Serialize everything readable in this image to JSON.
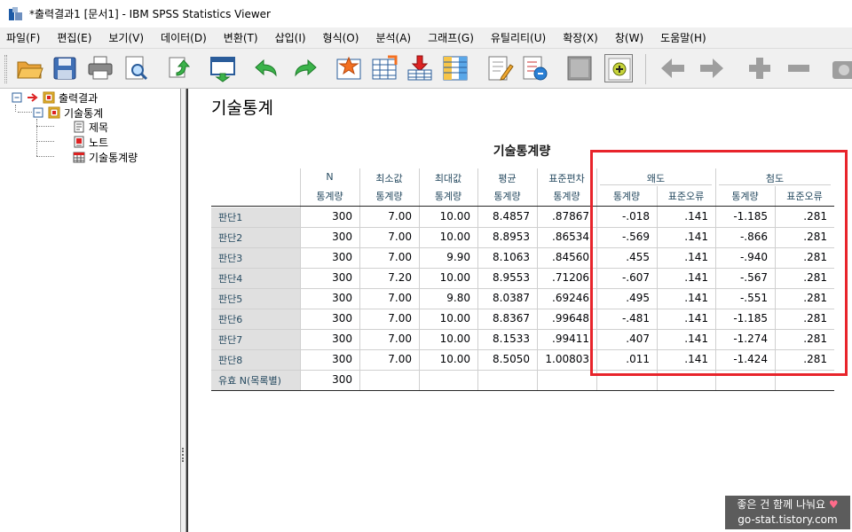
{
  "window": {
    "title": "*출력결과1 [문서1] - IBM SPSS Statistics Viewer"
  },
  "menu": [
    "파일(F)",
    "편집(E)",
    "보기(V)",
    "데이터(D)",
    "변환(T)",
    "삽입(I)",
    "형식(O)",
    "분석(A)",
    "그래프(G)",
    "유틸리티(U)",
    "확장(X)",
    "창(W)",
    "도움말(H)"
  ],
  "toolbar": {
    "icons": [
      "open-icon",
      "save-icon",
      "print-icon",
      "print-preview-icon",
      "export-icon",
      "goto-data-icon",
      "undo-icon",
      "redo-icon",
      "goto-case-icon",
      "goto-variable-icon",
      "insert-cases-icon",
      "split-file-icon",
      "select-cases-icon",
      "value-labels-icon",
      "designate-window-icon",
      "show-all-icon",
      "promote-icon",
      "demote-icon",
      "expand-icon",
      "collapse-icon",
      "show-icon"
    ]
  },
  "outline": {
    "root": "출력결과",
    "section": "기술통계",
    "children": [
      "제목",
      "노트",
      "기술통계량"
    ]
  },
  "output": {
    "heading": "기술통계"
  },
  "table": {
    "title": "기술통계량",
    "header": {
      "n": "N",
      "min": "최소값",
      "max": "최대값",
      "mean": "평균",
      "std": "표준편차",
      "skew": "왜도",
      "kurt": "첨도",
      "stat": "통계량",
      "se": "표준오류"
    },
    "rows": [
      {
        "label": "판단1",
        "values": [
          "300",
          "7.00",
          "10.00",
          "8.4857",
          ".87867",
          "-.018",
          ".141",
          "-1.185",
          ".281"
        ]
      },
      {
        "label": "판단2",
        "values": [
          "300",
          "7.00",
          "10.00",
          "8.8953",
          ".86534",
          "-.569",
          ".141",
          "-.866",
          ".281"
        ]
      },
      {
        "label": "판단3",
        "values": [
          "300",
          "7.00",
          "9.90",
          "8.1063",
          ".84560",
          ".455",
          ".141",
          "-.940",
          ".281"
        ]
      },
      {
        "label": "판단4",
        "values": [
          "300",
          "7.20",
          "10.00",
          "8.9553",
          ".71206",
          "-.607",
          ".141",
          "-.567",
          ".281"
        ]
      },
      {
        "label": "판단5",
        "values": [
          "300",
          "7.00",
          "9.80",
          "8.0387",
          ".69246",
          ".495",
          ".141",
          "-.551",
          ".281"
        ]
      },
      {
        "label": "판단6",
        "values": [
          "300",
          "7.00",
          "10.00",
          "8.8367",
          ".99648",
          "-.481",
          ".141",
          "-1.185",
          ".281"
        ]
      },
      {
        "label": "판단7",
        "values": [
          "300",
          "7.00",
          "10.00",
          "8.1533",
          ".99411",
          ".407",
          ".141",
          "-1.274",
          ".281"
        ]
      },
      {
        "label": "판단8",
        "values": [
          "300",
          "7.00",
          "10.00",
          "8.5050",
          "1.00803",
          ".011",
          ".141",
          "-1.424",
          ".281"
        ]
      }
    ],
    "valid_row": {
      "label": "유효 N(목록별)",
      "values": [
        "300",
        "",
        "",
        "",
        "",
        "",
        "",
        "",
        ""
      ]
    }
  },
  "watermark": {
    "line1": "좋은 건 함께 나눠요",
    "heart": "♥",
    "line2": "go-stat.tistory.com"
  },
  "colors": {
    "highlight": "#e8242b",
    "header_text": "#264a60",
    "row_label_bg": "#e0e0e0"
  }
}
